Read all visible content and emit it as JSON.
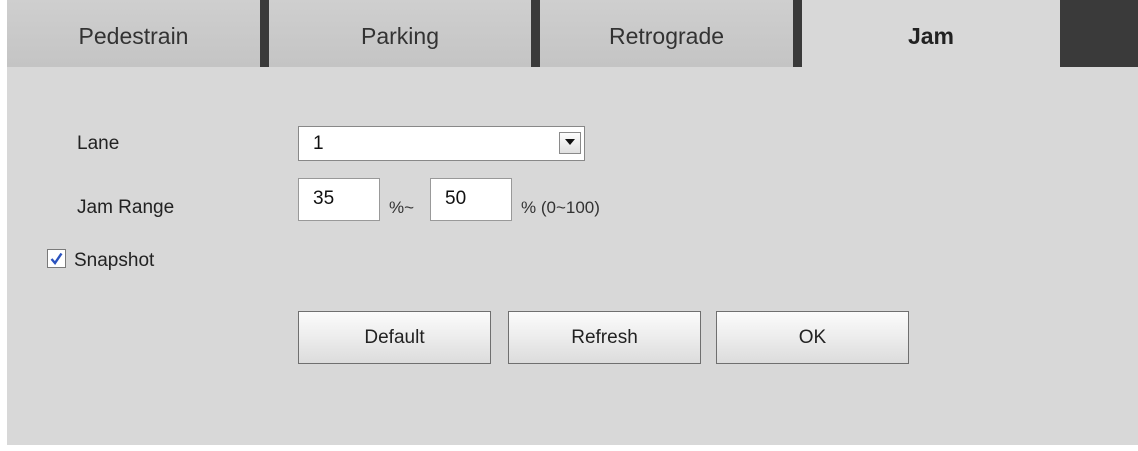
{
  "tabs": [
    {
      "label": "Pedestrain",
      "active": false
    },
    {
      "label": "Parking",
      "active": false
    },
    {
      "label": "Retrograde",
      "active": false
    },
    {
      "label": "Jam",
      "active": true
    }
  ],
  "form": {
    "lane_label": "Lane",
    "lane_value": "1",
    "jam_range_label": "Jam Range",
    "jam_min": "35",
    "jam_separator": "%~",
    "jam_max": "50",
    "jam_unit": "% (0~100)",
    "snapshot_label": "Snapshot",
    "snapshot_checked": true
  },
  "buttons": {
    "default": "Default",
    "refresh": "Refresh",
    "ok": "OK"
  },
  "colors": {
    "panel_bg": "#d8d8d8",
    "tab_separator": "#3a3a3a",
    "checkmark": "#2a52be"
  }
}
